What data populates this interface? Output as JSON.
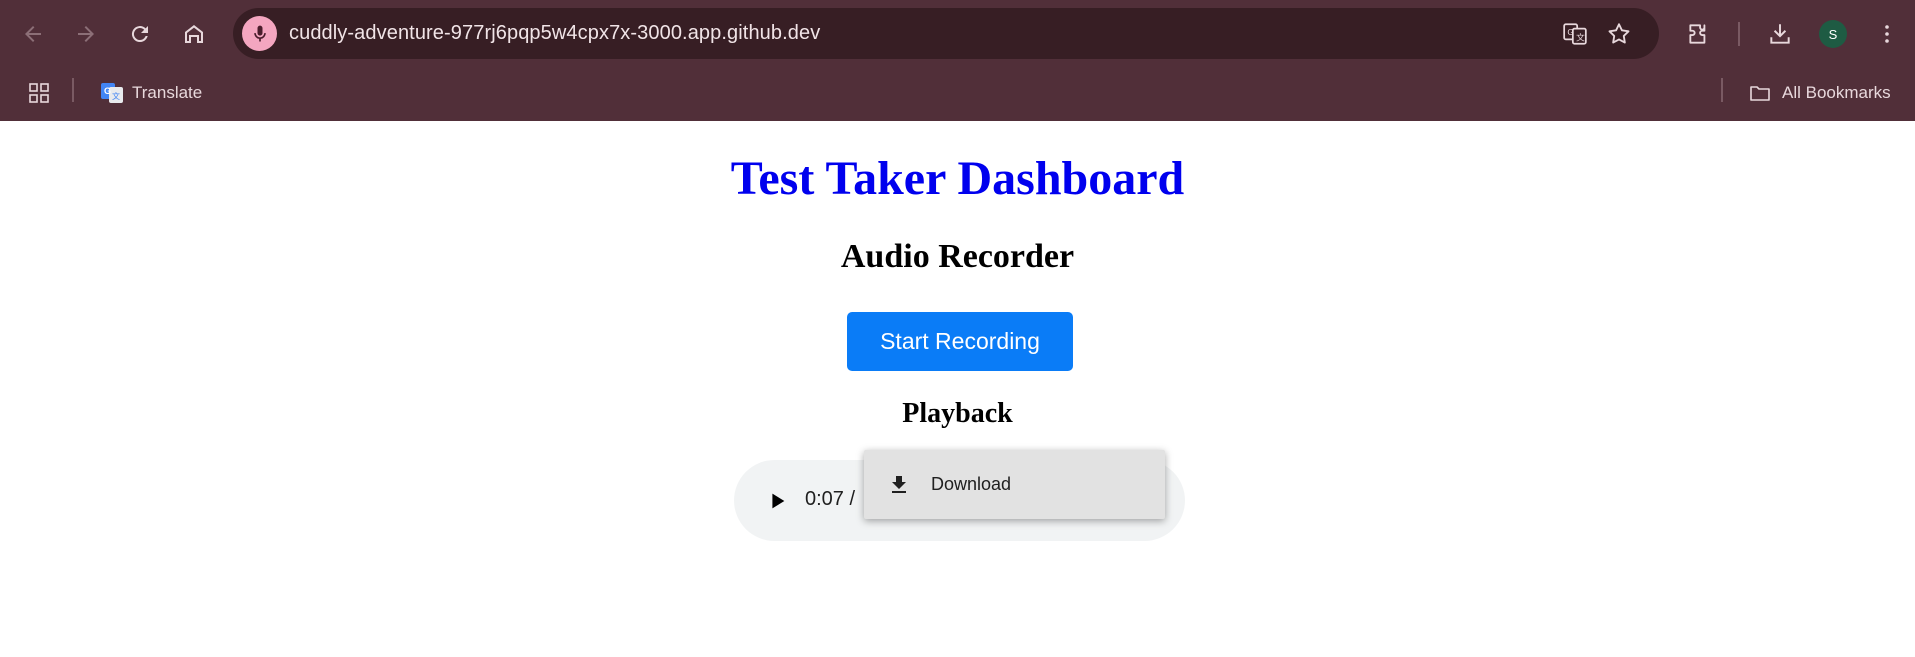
{
  "browser": {
    "url": "cuddly-adventure-977rj6pqp5w4cpx7x-3000.app.github.dev",
    "profile_initial": "S",
    "colors": {
      "frame": "#512f39",
      "omnibox": "#371e24",
      "mic": "#f4a6c0",
      "avatar": "#1e5b43"
    },
    "toolbar_icons": [
      "back-icon",
      "forward-icon",
      "reload-icon",
      "home-icon",
      "mic-icon",
      "translate-icon",
      "star-icon",
      "extensions-icon",
      "download-icon",
      "avatar",
      "menu-icon"
    ]
  },
  "bookmarks": {
    "translate_label": "Translate",
    "all_bookmarks_label": "All Bookmarks"
  },
  "page": {
    "title": "Test Taker Dashboard",
    "subtitle": "Audio Recorder",
    "record_button": "Start Recording",
    "playback_heading": "Playback",
    "audio": {
      "current_time": "0:07 /"
    },
    "context_menu": {
      "download_label": "Download"
    },
    "colors": {
      "title": "#0000ee",
      "button": "#0a7cf7",
      "player": "#f1f3f4"
    }
  }
}
